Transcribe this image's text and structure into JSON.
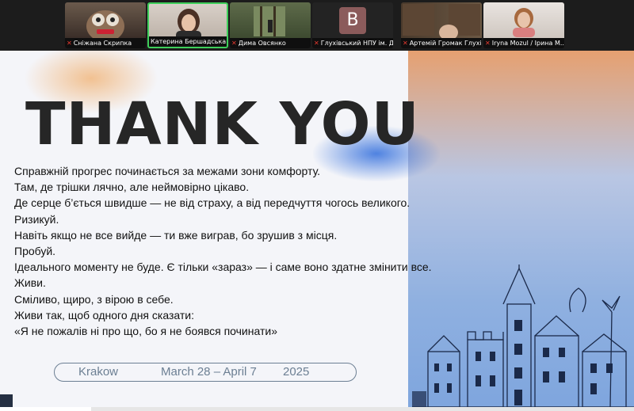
{
  "participants": [
    {
      "name": "Сніжана Скрипка",
      "muted": true
    },
    {
      "name": "Катерина Бершадська",
      "muted": false
    },
    {
      "name": "Дима Овсянко",
      "muted": true
    },
    {
      "name": "Глухівський НПУ ім. Д...",
      "muted": true,
      "initial": "B"
    },
    {
      "name": "Артемій Громак Глухі...",
      "muted": true
    },
    {
      "name": "Iryna Mozul / Ірина М...",
      "muted": true
    }
  ],
  "slide": {
    "title": "THANK YOU",
    "lines": [
      "Справжній прогрес починається за межами зони комфорту.",
      " Там, де трішки лячно, але неймовірно цікаво.",
      " Де серце б’ється швидше — не від страху, а від передчуття чогось великого.",
      "Ризикуй.",
      " Навіть якщо не все вийде — ти вже виграв, бо зрушив з місця.",
      "Пробуй.",
      " Ідеального моменту не буде. Є тільки «зараз» — і саме воно здатне змінити все.",
      "Живи.",
      " Сміливо, щиро, з вірою в себе.",
      " Живи так, щоб одного дня сказати:",
      " «Я не пожалів ні про що, бо я не боявся починати»"
    ],
    "location": "Krakow",
    "dates": "March 28 – April 7",
    "year": "2025"
  },
  "colors": {
    "active_speaker": "#3ecf5a",
    "muted": "#e5392f",
    "pill": "#6c7f93"
  }
}
